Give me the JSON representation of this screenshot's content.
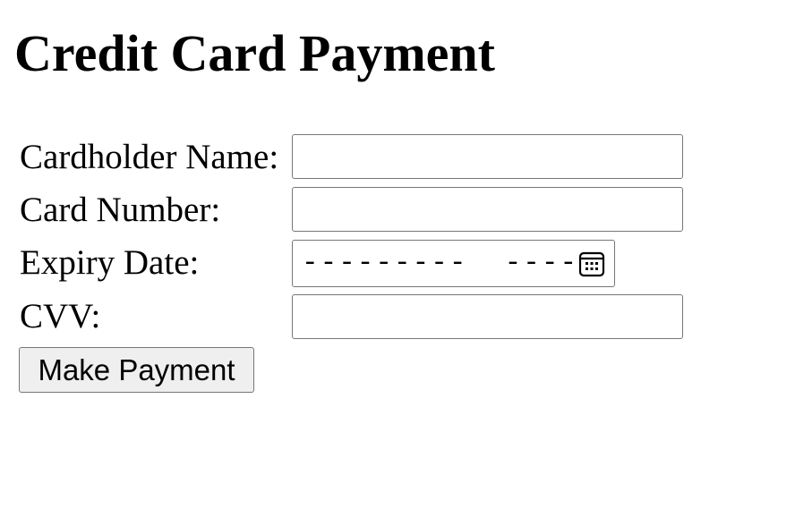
{
  "page": {
    "title": "Credit Card Payment"
  },
  "form": {
    "cardholder_name": {
      "label": "Cardholder Name:",
      "value": ""
    },
    "card_number": {
      "label": "Card Number:",
      "value": ""
    },
    "expiry_date": {
      "label": "Expiry Date:",
      "display": "---------  ----",
      "icon": "calendar-icon"
    },
    "cvv": {
      "label": "CVV:",
      "value": ""
    },
    "submit_label": "Make Payment"
  }
}
